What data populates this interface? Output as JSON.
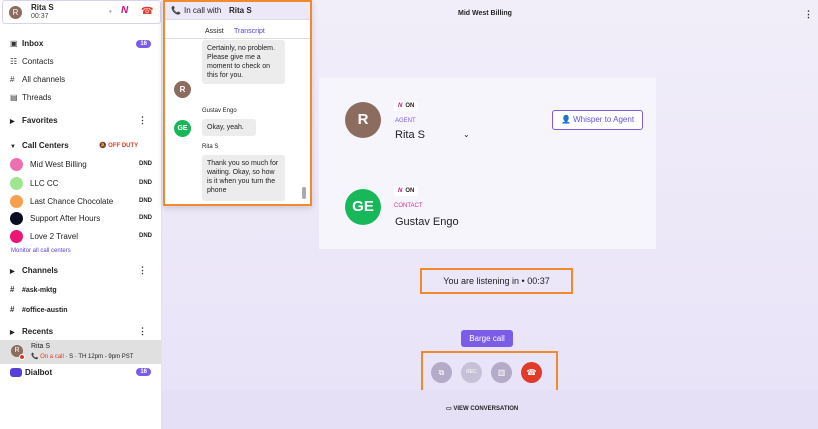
{
  "call_bar": {
    "caller_name": "Rita S",
    "timer": "00:37",
    "avatar_initial": "R"
  },
  "nav": {
    "inbox": "Inbox",
    "inbox_badge": "16",
    "contacts": "Contacts",
    "all_channels": "All channels",
    "threads": "Threads"
  },
  "favorites": {
    "label": "Favorites"
  },
  "call_centers": {
    "label": "Call Centers",
    "status": "OFF DUTY",
    "items": [
      {
        "name": "Mid West Billing",
        "status": "DND",
        "color": "#ec6fb0"
      },
      {
        "name": "LLC CC",
        "status": "DND",
        "color": "#9ee58f"
      },
      {
        "name": "Last Chance Chocolate",
        "status": "DND",
        "color": "#f6a04d"
      },
      {
        "name": "Support After Hours",
        "status": "DND",
        "color": "#0c0c24"
      },
      {
        "name": "Love 2 Travel",
        "status": "DND",
        "color": "#ea1574"
      }
    ],
    "monitor_link": "Monitor all call centers"
  },
  "channels": {
    "label": "Channels",
    "items": [
      "#ask-mktg",
      "#office-austin"
    ]
  },
  "recents": {
    "label": "Recents",
    "item_name": "Rita S",
    "item_detail_status": "On a call",
    "item_detail_rest": " · S · TH 12pm - 9pm PST"
  },
  "dialbot": {
    "label": "Dialbot",
    "badge": "16"
  },
  "popup": {
    "title_prefix": "In call with",
    "title_name": "Rita S",
    "tabs": [
      "Assist",
      "Transcript"
    ],
    "messages": [
      {
        "speaker": "",
        "initial": "R",
        "text": "Certainly, no problem. Please give me a moment to check on this for you."
      },
      {
        "speaker": "Gustav Engo",
        "initial": "GE",
        "text": "Okay, yeah."
      },
      {
        "speaker": "Rita S",
        "initial": "",
        "text": "Thank you so much for waiting. Okay, so how is it when you turn the phone"
      }
    ]
  },
  "header": {
    "title": "Mid West Billing"
  },
  "agent": {
    "initial": "R",
    "on_label": "ON",
    "role": "AGENT",
    "name": "Rita S"
  },
  "contact": {
    "initial": "GE",
    "on_label": "ON",
    "role": "CONTACT",
    "name": "Gustav Engo"
  },
  "whisper": {
    "label": "Whisper to Agent"
  },
  "listening": {
    "text": "You are listening in",
    "sep": "•",
    "timer": "00:37"
  },
  "controls": {
    "barge_label": "Barge call",
    "rec_label": "REC"
  },
  "footer": {
    "view_conversation": "VIEW CONVERSATION"
  },
  "colors": {
    "accent": "#7b5ce6",
    "highlight": "#f08a2c",
    "danger": "#e23a2a"
  }
}
